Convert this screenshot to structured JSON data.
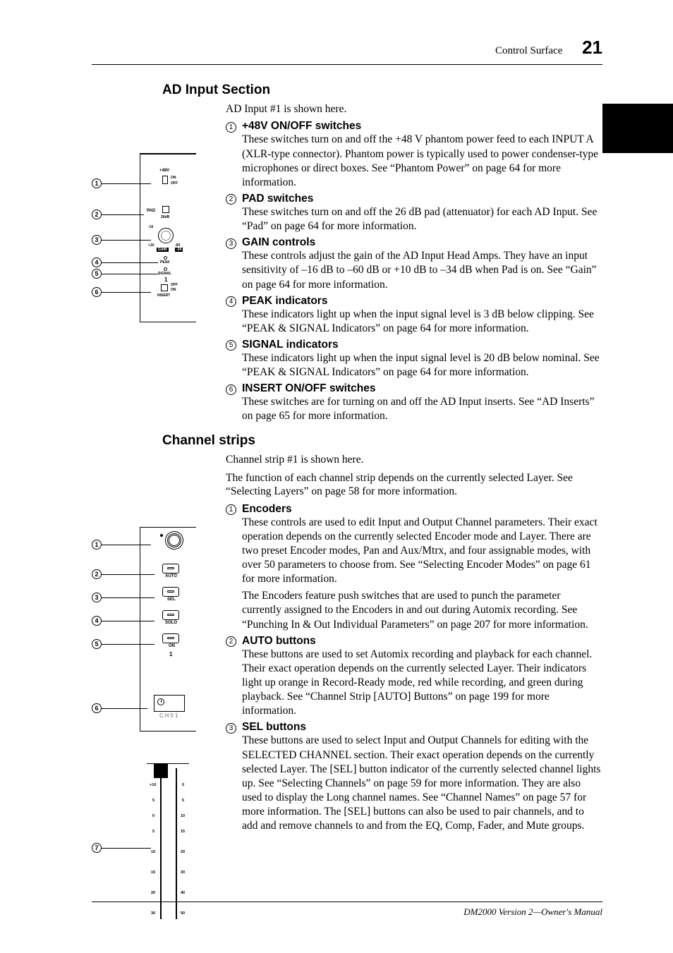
{
  "header": {
    "section": "Control Surface",
    "page": "21"
  },
  "footer": "DM2000 Version 2—Owner's Manual",
  "ad": {
    "title": "AD Input Section",
    "intro": "AD Input #1 is shown here.",
    "items": [
      {
        "n": "1",
        "title": "+48V ON/OFF switches",
        "body": "These switches turn on and off the +48 V phantom power feed to each INPUT A (XLR-type connector). Phantom power is typically used to power condenser-type microphones or direct boxes. See “Phantom Power” on page 64 for more information."
      },
      {
        "n": "2",
        "title": "PAD switches",
        "body": "These switches turn on and off the 26 dB pad (attenuator) for each AD Input. See “Pad” on page 64 for more information."
      },
      {
        "n": "3",
        "title": "GAIN controls",
        "body": "These controls adjust the gain of the AD Input Head Amps. They have an input sensitivity of –16 dB to –60 dB or +10 dB to –34 dB when Pad is on. See “Gain” on page 64 for more information."
      },
      {
        "n": "4",
        "title": "PEAK indicators",
        "body": "These indicators light up when the input signal level is 3 dB below clipping. See “PEAK & SIGNAL Indicators” on page 64 for more information."
      },
      {
        "n": "5",
        "title": "SIGNAL indicators",
        "body": "These indicators light up when the input signal level is 20 dB below nominal. See “PEAK & SIGNAL Indicators” on page 64 for more information."
      },
      {
        "n": "6",
        "title": "INSERT ON/OFF switches",
        "body": "These switches are for turning on and off the AD Input inserts. See “AD Inserts” on page 65 for more information."
      }
    ],
    "labels": {
      "p48v": "+48V",
      "on": "ON",
      "off": "OFF",
      "pad": "PAD",
      "pad26": "26dB",
      "gain_l": "+10",
      "gain_r": "-60",
      "gain": "GAIN",
      "gain_min": "-16",
      "gain_max": "-34",
      "peak": "PEAK",
      "signal": "SIGNAL",
      "ch": "1",
      "insert": "INSERT"
    }
  },
  "cs": {
    "title": "Channel strips",
    "intro1": "Channel strip #1 is shown here.",
    "intro2": "The function of each channel strip depends on the currently selected Layer. See “Selecting Layers” on page 58 for more information.",
    "items": [
      {
        "n": "1",
        "title": "Encoders",
        "body1": "These controls are used to edit Input and Output Channel parameters. Their exact operation depends on the currently selected Encoder mode and Layer. There are two preset Encoder modes, Pan and Aux/Mtrx, and four assignable modes, with over 50 parameters to choose from. See “Selecting Encoder Modes” on page 61 for more information.",
        "body2": "The Encoders feature push switches that are used to punch the parameter currently assigned to the Encoders in and out during Automix recording. See “Punching In & Out Individual Parameters” on page 207 for more information."
      },
      {
        "n": "2",
        "title": "AUTO buttons",
        "body": "These buttons are used to set Automix recording and playback for each channel. Their exact operation depends on the currently selected Layer. Their indicators light up orange in Record-Ready mode, red while recording, and green during playback. See “Channel Strip [AUTO] Buttons” on page 199 for more information."
      },
      {
        "n": "3",
        "title": "SEL buttons",
        "body": "These buttons are used to select Input and Output Channels for editing with the SELECTED CHANNEL section. Their exact operation depends on the currently selected Layer. The [SEL] button indicator of the currently selected channel lights up. See “Selecting Channels” on page 59 for more information. They are also used to display the Long channel names. See “Channel Names” on page 57 for more information. The [SEL] buttons can also be used to pair channels, and to add and remove channels to and from the EQ, Comp, Fader, and Mute groups."
      }
    ],
    "labels": {
      "auto": "AUTO",
      "sel": "SEL",
      "solo": "SOLO",
      "on": "ON",
      "ch": "1",
      "chdisp": "CH01",
      "ticks_left": [
        "+10",
        "5",
        "0",
        "5",
        "10",
        "15",
        "20",
        "30"
      ],
      "ticks_right": [
        "0",
        "5",
        "10",
        "15",
        "20",
        "30",
        "40",
        "50"
      ]
    }
  }
}
